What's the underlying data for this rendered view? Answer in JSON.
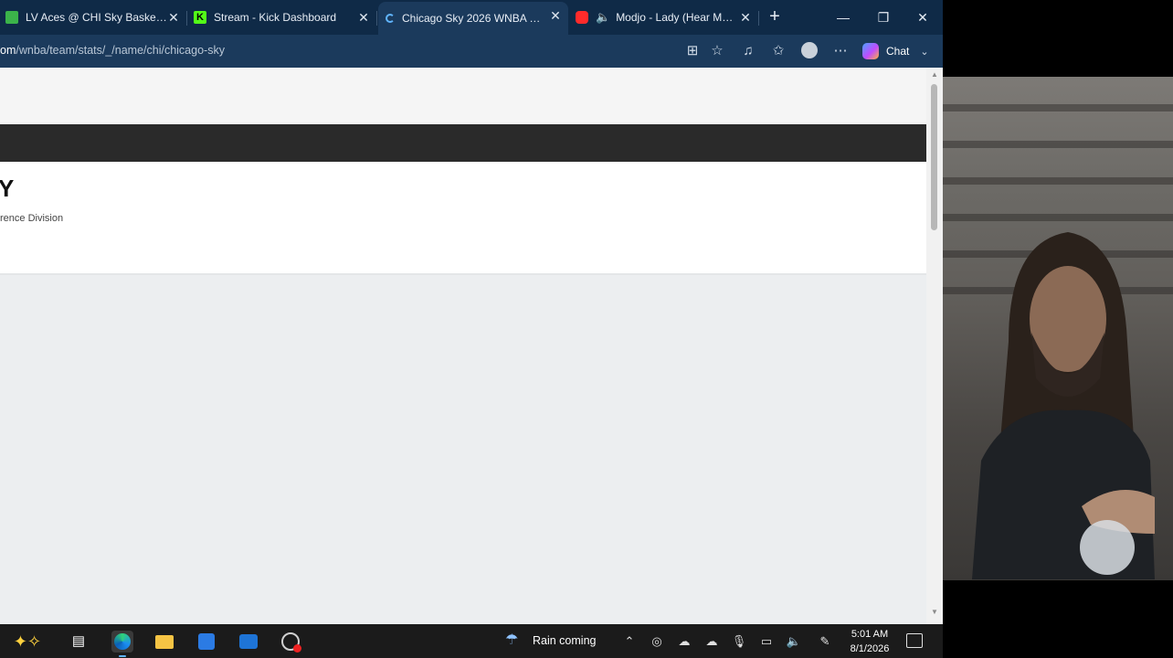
{
  "tabs": [
    {
      "label": "LV Aces @ CHI Sky Basketball B",
      "favicon": "green-logo",
      "active": false
    },
    {
      "label": "Stream - Kick Dashboard",
      "favicon": "kick-k",
      "active": false
    },
    {
      "label": "Chicago Sky 2026 WNBA Regul",
      "favicon": "loading-spinner",
      "active": true
    },
    {
      "label": "Modjo - Lady (Hear Me To",
      "favicon": "youtube",
      "active": false,
      "audio": true
    }
  ],
  "address": {
    "url_host": "om",
    "url_path": "/wnba/team/stats/_/name/chi/chicago-sky"
  },
  "toolbar": {
    "chat_label": "Chat"
  },
  "page": {
    "team_name_fragment": "Y",
    "division_fragment": "rence Division"
  },
  "taskbar": {
    "weather_text": "Rain coming",
    "time": "5:01 AM",
    "date": "8/1/2026"
  },
  "colors": {
    "tabbar": "#0f2a47",
    "toolbar": "#1b3a5c",
    "accent": "#60b5ff"
  }
}
